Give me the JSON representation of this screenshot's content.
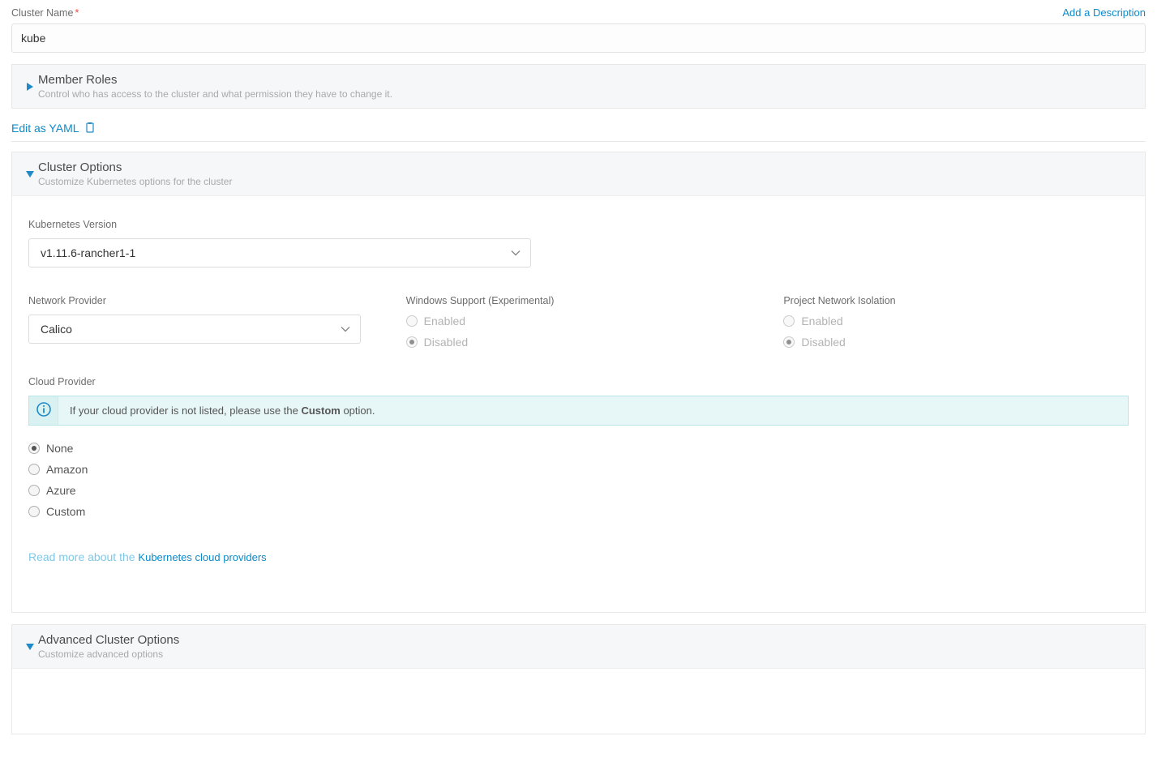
{
  "top": {
    "cluster_name_label": "Cluster Name",
    "add_description": "Add a Description",
    "cluster_name_value": "kube"
  },
  "memberRoles": {
    "title": "Member Roles",
    "subtitle": "Control who has access to the cluster and what permission they have to change it."
  },
  "yaml": {
    "label": "Edit as YAML"
  },
  "clusterOptions": {
    "title": "Cluster Options",
    "subtitle": "Customize Kubernetes options for the cluster"
  },
  "k8sVersion": {
    "label": "Kubernetes Version",
    "value": "v1.11.6-rancher1-1"
  },
  "networkProvider": {
    "label": "Network Provider",
    "value": "Calico"
  },
  "windowsSupport": {
    "label": "Windows Support (Experimental)",
    "enabled": "Enabled",
    "disabled": "Disabled"
  },
  "projectIso": {
    "label": "Project Network Isolation",
    "enabled": "Enabled",
    "disabled": "Disabled"
  },
  "cloudProvider": {
    "label": "Cloud Provider",
    "banner_prefix": "If your cloud provider is not listed, please use the ",
    "banner_bold": "Custom",
    "banner_suffix": " option.",
    "opts": {
      "none": "None",
      "amazon": "Amazon",
      "azure": "Azure",
      "custom": "Custom"
    },
    "readmore_prefix": "Read more about the ",
    "readmore_link": "Kubernetes cloud providers"
  },
  "advanced": {
    "title": "Advanced Cluster Options",
    "subtitle": "Customize advanced options"
  }
}
